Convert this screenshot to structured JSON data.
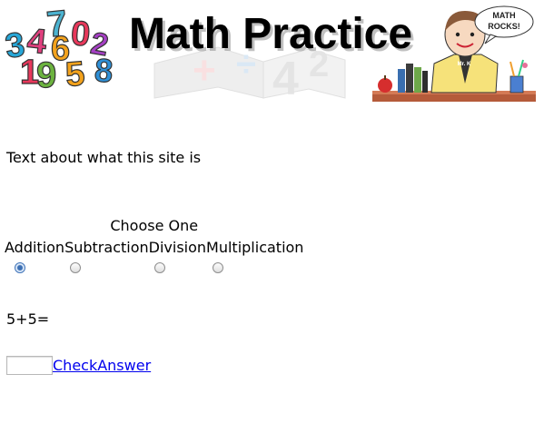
{
  "banner": {
    "title": "Math Practice",
    "numbers_logo": [
      "3",
      "4",
      "7",
      "6",
      "0",
      "2",
      "1",
      "9",
      "5",
      "8"
    ],
    "speech_bubble": [
      "MATH",
      "ROCKS!"
    ],
    "character_badge": "Mr. K"
  },
  "intro_text": "Text about what this site is",
  "chooser": {
    "caption": "Choose One",
    "options": [
      {
        "label": "Addition",
        "checked": true
      },
      {
        "label": "Subtraction",
        "checked": false
      },
      {
        "label": "Division",
        "checked": false
      },
      {
        "label": "Multiplication",
        "checked": false
      }
    ]
  },
  "question": "5+5=",
  "answer": {
    "value": "",
    "button_label": "CheckAnswer"
  }
}
